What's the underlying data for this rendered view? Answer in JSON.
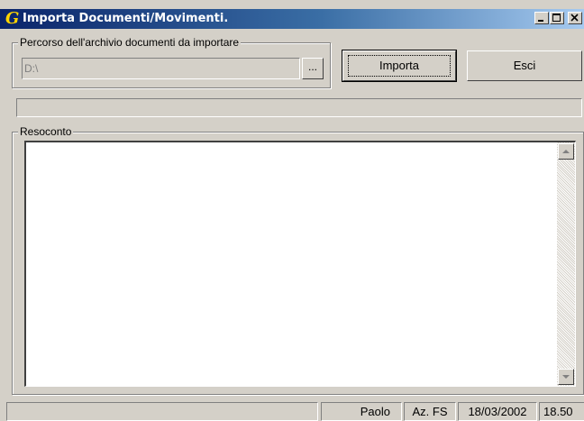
{
  "window": {
    "title": "Importa Documenti/Movimenti.",
    "app_icon_glyph": "G",
    "app_icon_color": "#ffd400"
  },
  "path_group": {
    "legend": "Percorso dell'archivio documenti da importare",
    "value": "D:\\",
    "browse_label": "..."
  },
  "buttons": {
    "importa": "Importa",
    "esci": "Esci"
  },
  "report": {
    "legend": "Resoconto",
    "content": ""
  },
  "status": {
    "user": "Paolo",
    "company": "Az. FS",
    "date": "18/03/2002",
    "time": "18.50"
  },
  "icons": [
    "app-icon",
    "minimize-icon",
    "maximize-icon",
    "close-icon",
    "scroll-up-icon",
    "scroll-down-icon"
  ]
}
